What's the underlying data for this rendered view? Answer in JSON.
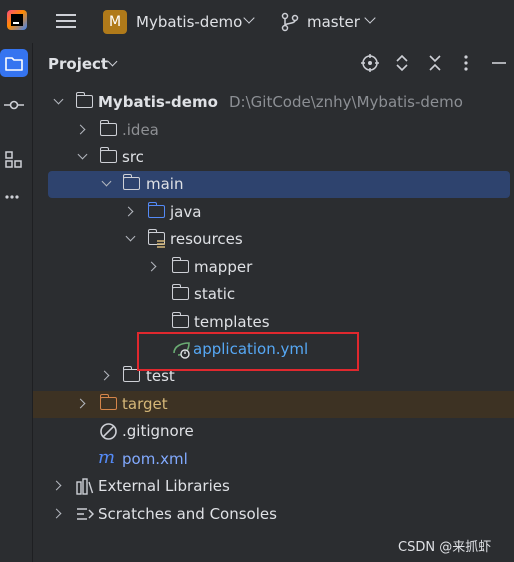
{
  "titlebar": {
    "project_badge": "M",
    "project_name": "Mybatis-demo",
    "branch": "master"
  },
  "panel": {
    "title": "Project"
  },
  "tree": {
    "root_name": "Mybatis-demo",
    "root_path": "D:\\GitCode\\znhy\\Mybatis-demo",
    "idea": ".idea",
    "src": "src",
    "main": "main",
    "java": "java",
    "resources": "resources",
    "mapper": "mapper",
    "static": "static",
    "templates": "templates",
    "application": "application.yml",
    "test": "test",
    "target": "target",
    "gitignore": ".gitignore",
    "pom": "pom.xml",
    "external": "External Libraries",
    "scratches": "Scratches and Consoles"
  },
  "watermark": "CSDN @来抓虾",
  "colors": {
    "accent": "#3574f0",
    "selection": "#2e436e",
    "excluded": "#3d3223",
    "highlight_box": "#e0282e"
  }
}
